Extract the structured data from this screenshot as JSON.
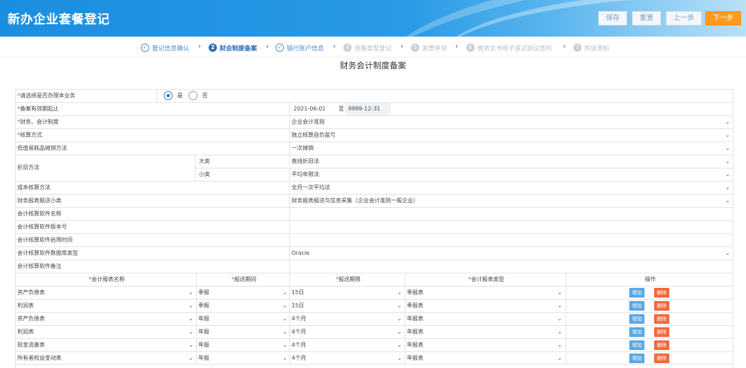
{
  "header": {
    "title": "新办企业套餐登记",
    "buttons": {
      "save": "保存",
      "reset": "重置",
      "prev": "上一步",
      "next": "下一步"
    }
  },
  "steps": [
    {
      "label": "登记信息确认",
      "state": "done",
      "mark": "✓"
    },
    {
      "label": "财会制度备案",
      "state": "active",
      "mark": "2"
    },
    {
      "label": "银行账户信息",
      "state": "done",
      "mark": "✓"
    },
    {
      "label": "资格类型登记",
      "state": "todo",
      "mark": "4"
    },
    {
      "label": "发票申领",
      "state": "todo",
      "mark": "5"
    },
    {
      "label": "税务文书电子送达协议签约",
      "state": "todo",
      "mark": "6"
    },
    {
      "label": "附送资料",
      "state": "todo",
      "mark": "7"
    }
  ],
  "page_title": "财务会计制度备案",
  "form": {
    "q_business": {
      "label": "请选择是否办理本业务",
      "yes": "是",
      "no": "否",
      "selected": "是"
    },
    "validity": {
      "label": "备案有效期起止",
      "start": "2021-06-01",
      "sep": "至",
      "end": "9999-12-31"
    },
    "accounting_system": {
      "label": "财务、会计制度",
      "value": "企业会计准则"
    },
    "accounting_method": {
      "label": "核算方式",
      "value": "独立核算自负盈亏"
    },
    "low_value": {
      "label": "低值易耗品摊销方法",
      "value": "一次摊销"
    },
    "depreciation": {
      "label": "折旧方法",
      "major_label": "大类",
      "major_value": "直线折旧法",
      "minor_label": "小类",
      "minor_value": "平均年限法"
    },
    "cost_method": {
      "label": "成本核算方法",
      "value": "全月一次平均法"
    },
    "report_sub": {
      "label": "财务报表报送小类",
      "value": "财务报表报送与信息采集（企业会计准则一般企业）"
    },
    "software_name": {
      "label": "会计核算软件名称",
      "value": ""
    },
    "software_version": {
      "label": "会计核算软件版本号",
      "value": ""
    },
    "software_start": {
      "label": "会计核算软件启用时间",
      "value": ""
    },
    "software_db": {
      "label": "会计核算软件数据库类型",
      "value": "Oracle"
    },
    "software_note": {
      "label": "会计核算软件备注",
      "value": ""
    }
  },
  "reports_table": {
    "headers": {
      "name": "会计报表名称",
      "period": "报送期间",
      "deadline": "报送期限",
      "type": "会计报表类型",
      "ops": "操作"
    },
    "add_label": "增加",
    "del_label": "删除",
    "rows": [
      {
        "name": "资产负债表",
        "period": "季报",
        "deadline": "15日",
        "type": "季报表"
      },
      {
        "name": "利润表",
        "period": "季报",
        "deadline": "15日",
        "type": "季报表"
      },
      {
        "name": "资产负债表",
        "period": "年报",
        "deadline": "4个月",
        "type": "年报表"
      },
      {
        "name": "利润表",
        "period": "年报",
        "deadline": "4个月",
        "type": "年报表"
      },
      {
        "name": "现金流量表",
        "period": "年报",
        "deadline": "4个月",
        "type": "年报表"
      },
      {
        "name": "所有者权益变动表",
        "period": "年报",
        "deadline": "4个月",
        "type": "年报表"
      }
    ]
  }
}
